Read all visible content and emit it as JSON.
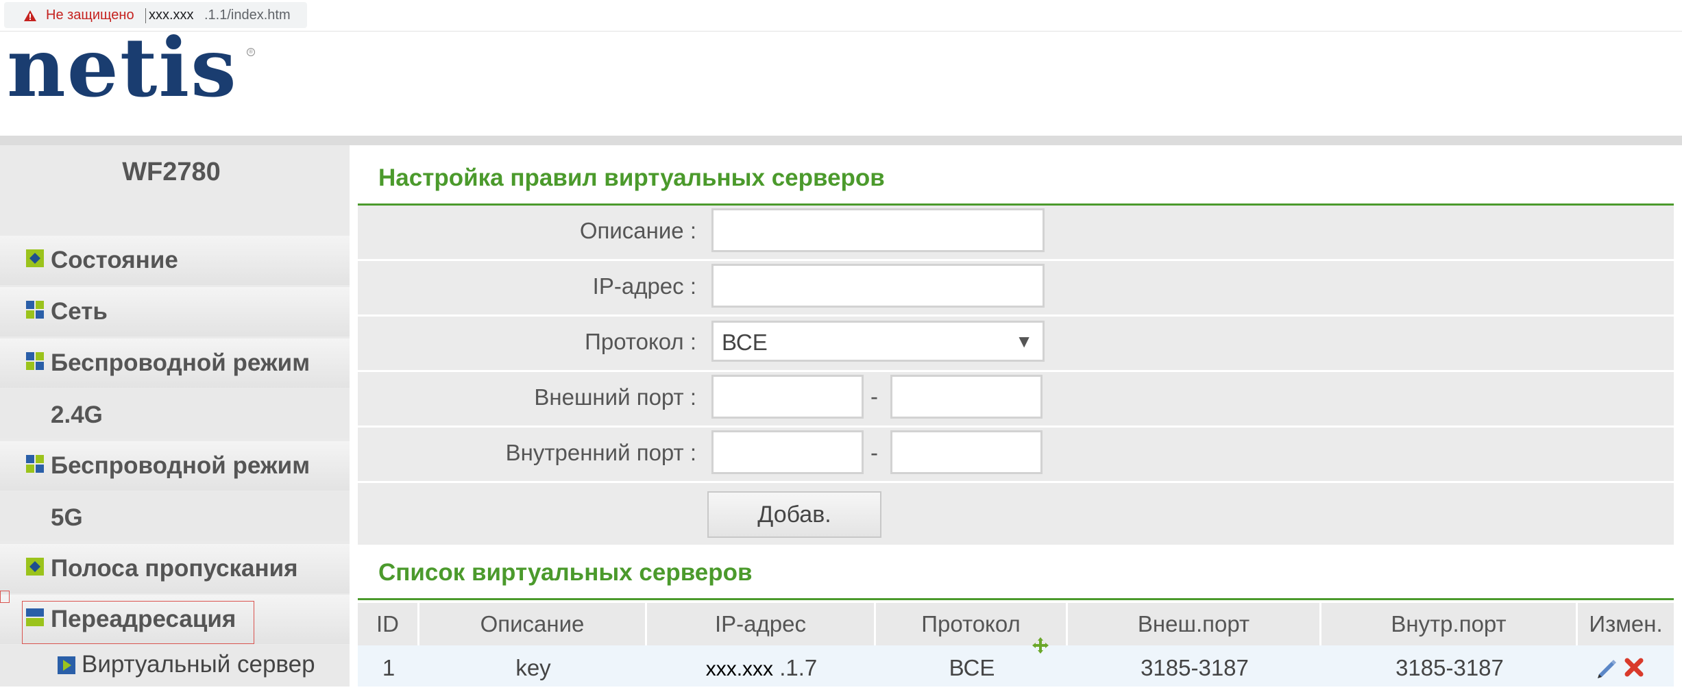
{
  "browser": {
    "security_warning": "Не защищено",
    "url_host": "xxx.xxx",
    "url_path": ".1.1/index.htm"
  },
  "logo": {
    "text": "netis",
    "registered_mark": "®"
  },
  "sidebar": {
    "model": "WF2780",
    "items": [
      {
        "label": "Состояние",
        "icon": "diamond-icon"
      },
      {
        "label": "Сеть",
        "icon": "grid-icon"
      },
      {
        "label": "Беспроводной режим",
        "icon": "grid-icon"
      },
      {
        "label": "2.4G"
      },
      {
        "label": "Беспроводной режим",
        "icon": "grid-icon"
      },
      {
        "label": "5G"
      },
      {
        "label": "Полоса пропускания",
        "icon": "diamond-icon"
      },
      {
        "label": "Переадресация",
        "icon": "bars-icon"
      }
    ],
    "subitem": {
      "label": "Виртуальный сервер",
      "icon": "play-icon"
    }
  },
  "form": {
    "title": "Настройка правил виртуальных серверов",
    "description_label": "Описание :",
    "ip_label": "IP-адрес :",
    "protocol_label": "Протокол :",
    "protocol_value": "ВСЕ",
    "ext_port_label": "Внешний порт :",
    "int_port_label": "Внутренний порт :",
    "dash": "-",
    "add_button": "Добав."
  },
  "list": {
    "title": "Список виртуальных серверов",
    "columns": [
      "ID",
      "Описание",
      "IP-адрес",
      "Протокол",
      "Внеш.порт",
      "Внутр.порт",
      "Измен."
    ],
    "rows": [
      {
        "id": "1",
        "description": "key",
        "ip_host": "xxx.xxx",
        "ip_suffix": " .1.7",
        "protocol": "ВСЕ",
        "ext_port": "3185-3187",
        "int_port": "3185-3187"
      }
    ]
  },
  "colors": {
    "accent_green": "#4b9a2c",
    "logo_blue": "#1a3d70",
    "warning_red": "#c5221f"
  }
}
